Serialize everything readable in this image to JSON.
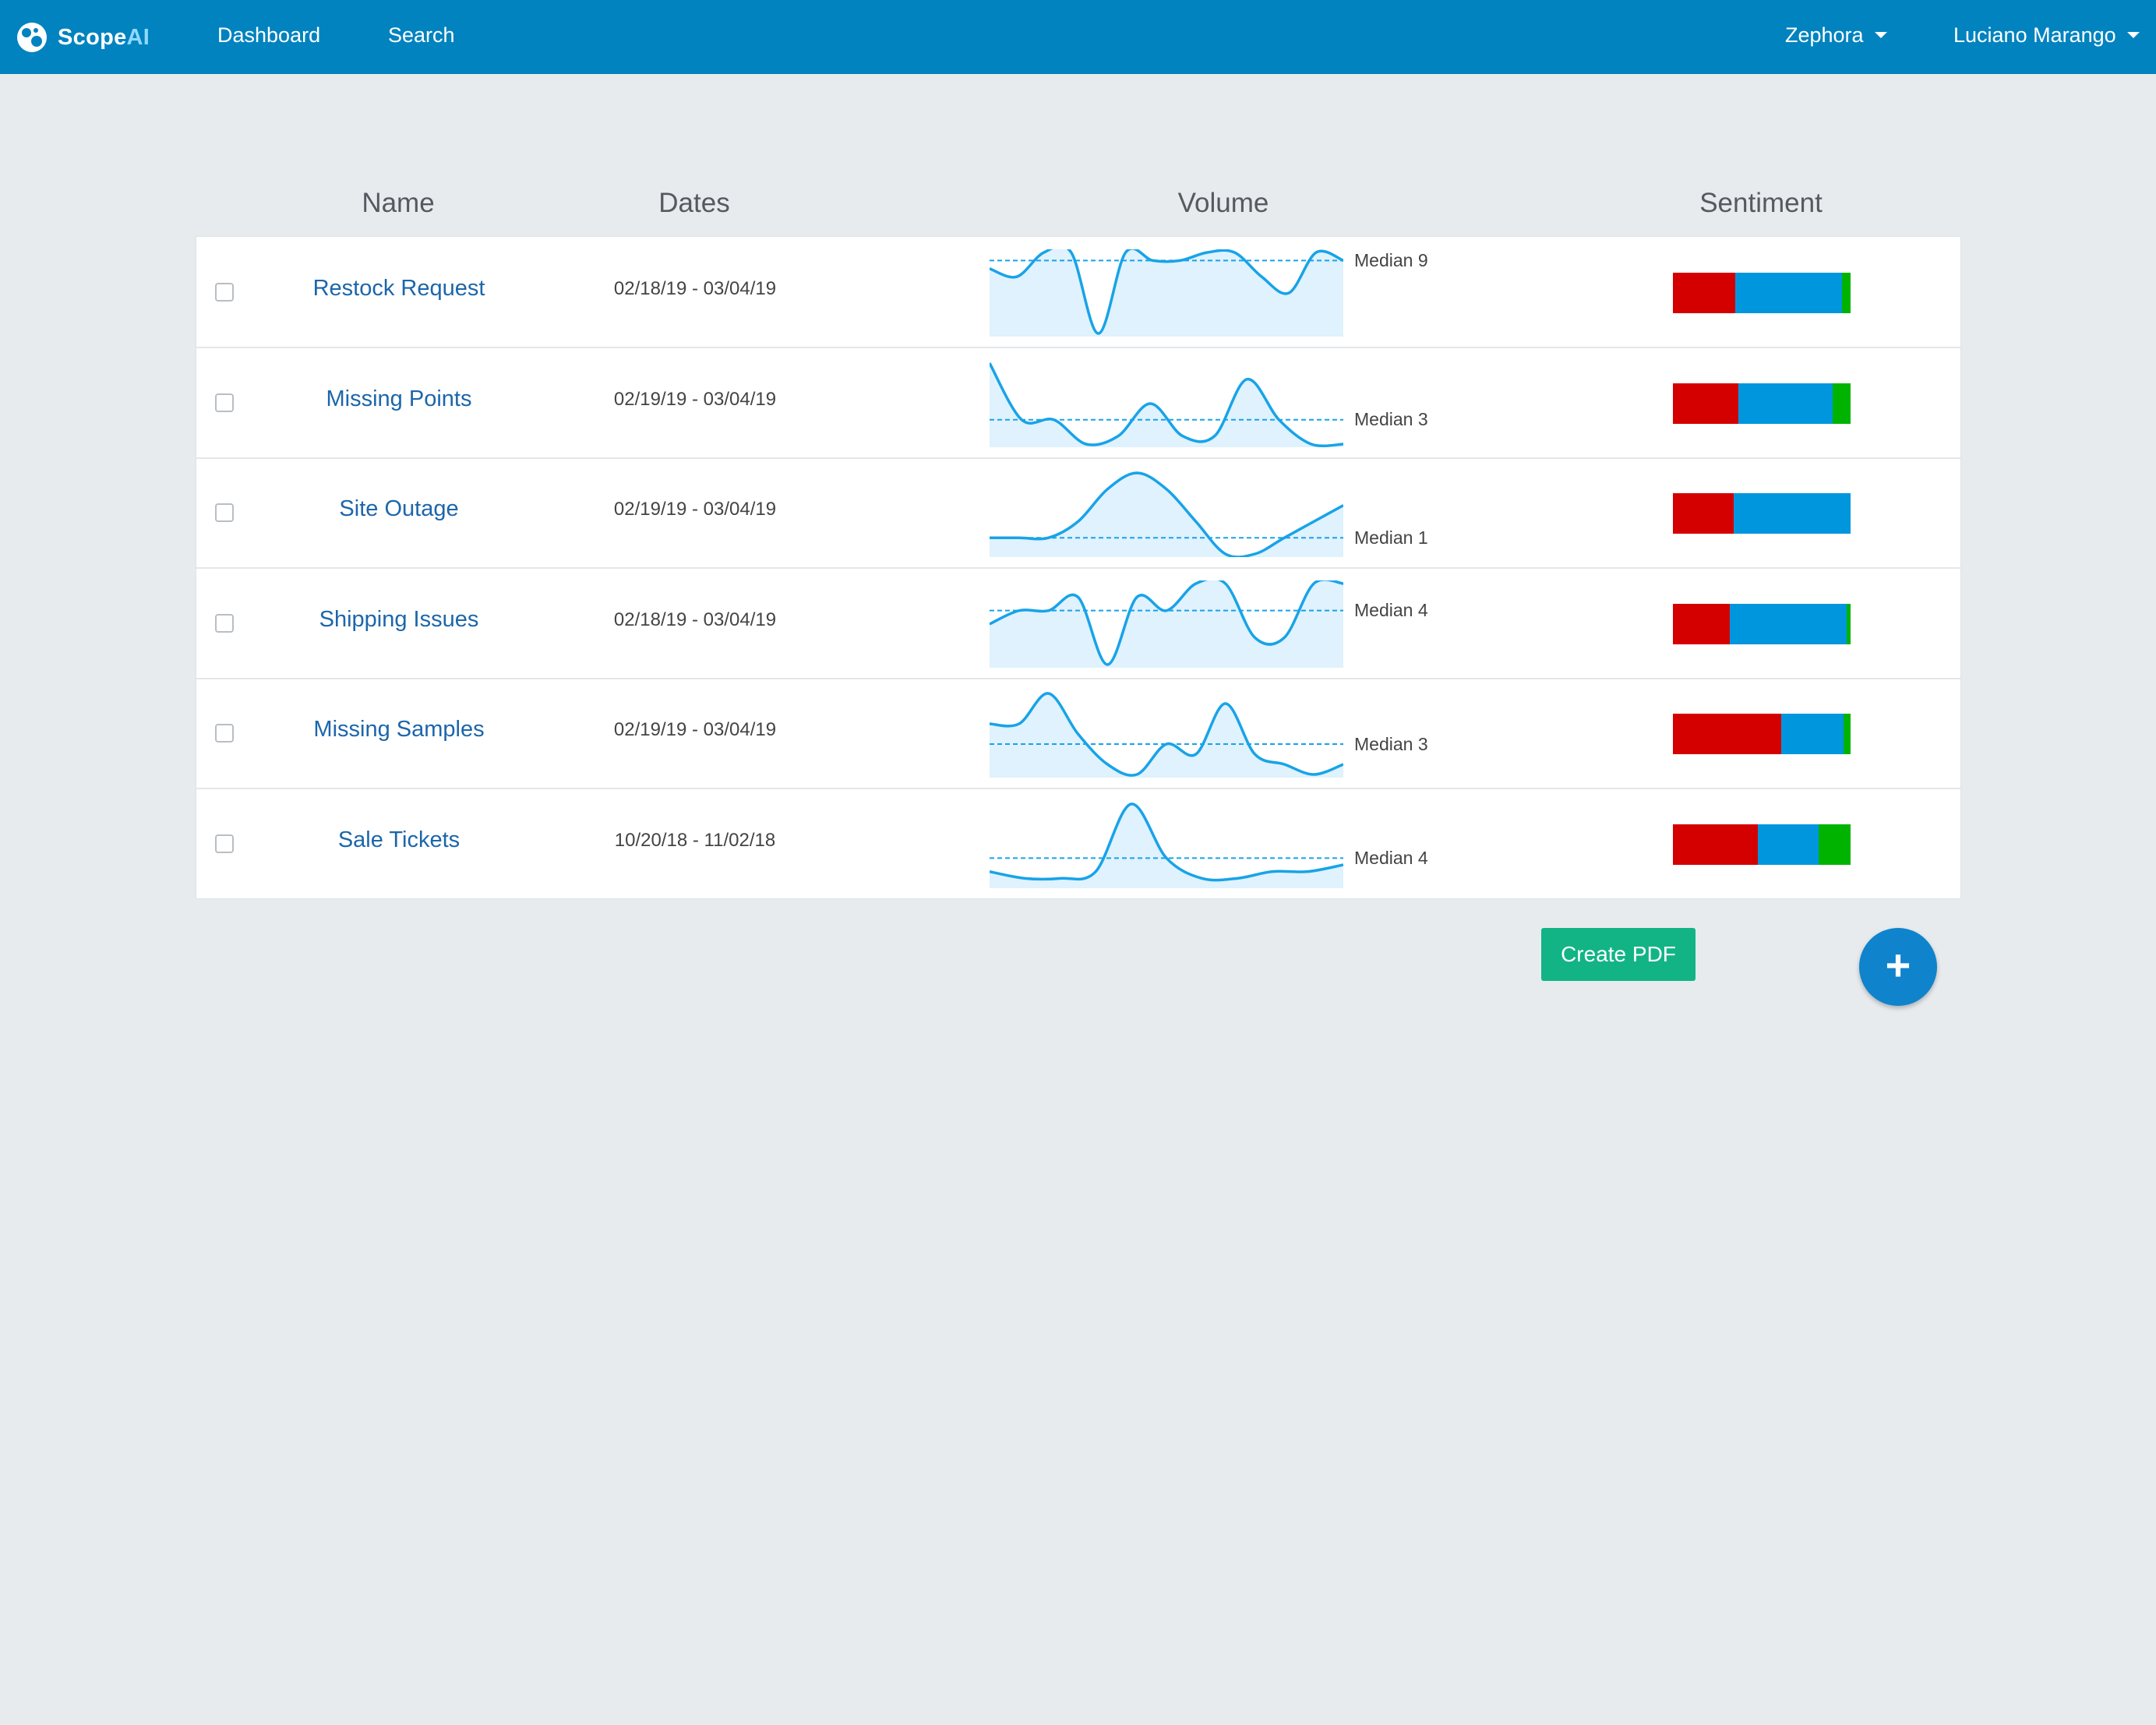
{
  "nav": {
    "brand_main": "Scope",
    "brand_accent": "AI",
    "links": [
      "Dashboard",
      "Search"
    ],
    "org_menu": "Zephora",
    "user_menu": "Luciano Marango"
  },
  "table": {
    "columns": {
      "name": "Name",
      "dates": "Dates",
      "volume": "Volume",
      "sentiment": "Sentiment"
    },
    "rows": [
      {
        "name": "Restock Request",
        "dates": "02/18/19 - 03/04/19",
        "median_label": "Median 9",
        "volume": [
          8,
          7,
          10,
          10,
          0,
          10,
          9,
          9,
          10,
          10,
          7,
          5,
          10,
          9
        ],
        "median": 9,
        "vmax": 10,
        "sentiment": [
          0.35,
          0.6,
          0.05
        ]
      },
      {
        "name": "Missing Points",
        "dates": "02/19/19 - 03/04/19",
        "median_label": "Median 3",
        "volume": [
          10,
          3,
          3,
          0,
          1,
          5,
          1,
          1,
          8,
          3,
          0,
          0
        ],
        "median": 3,
        "vmax": 10,
        "sentiment": [
          0.37,
          0.53,
          0.1
        ]
      },
      {
        "name": "Site Outage",
        "dates": "02/19/19 - 03/04/19",
        "median_label": "Median 1",
        "volume": [
          1,
          1,
          1,
          2,
          4,
          5,
          4,
          2,
          0,
          0,
          1,
          2,
          3
        ],
        "median": 1,
        "vmax": 5,
        "sentiment": [
          0.34,
          0.66,
          0
        ]
      },
      {
        "name": "Shipping Issues",
        "dates": "02/18/19 - 03/04/19",
        "median_label": "Median 4",
        "volume": [
          3,
          4,
          4,
          5,
          0,
          5,
          4,
          6,
          6,
          2,
          2,
          6,
          6
        ],
        "median": 4,
        "vmax": 6,
        "sentiment": [
          0.32,
          0.66,
          0.02
        ]
      },
      {
        "name": "Missing Samples",
        "dates": "02/19/19 - 03/04/19",
        "median_label": "Median 3",
        "volume": [
          5,
          5,
          8,
          4,
          1,
          0,
          3,
          2,
          7,
          2,
          1,
          0,
          1
        ],
        "median": 3,
        "vmax": 8,
        "sentiment": [
          0.61,
          0.35,
          0.04
        ]
      },
      {
        "name": "Sale Tickets",
        "dates": "10/20/18 - 11/02/18",
        "median_label": "Median 4",
        "volume": [
          2,
          1,
          1,
          2,
          12,
          4,
          1,
          1,
          2,
          2,
          3
        ],
        "median": 4,
        "vmax": 12,
        "sentiment": [
          0.48,
          0.34,
          0.18
        ]
      }
    ]
  },
  "sentiment_colors": [
    "#d40000",
    "#0096dd",
    "#00b300"
  ],
  "spark_colors": {
    "line": "#18a3e8",
    "fill": "#dff2fd",
    "median": "#18a3e8"
  },
  "actions": {
    "create_pdf": "Create PDF",
    "add": "+"
  }
}
